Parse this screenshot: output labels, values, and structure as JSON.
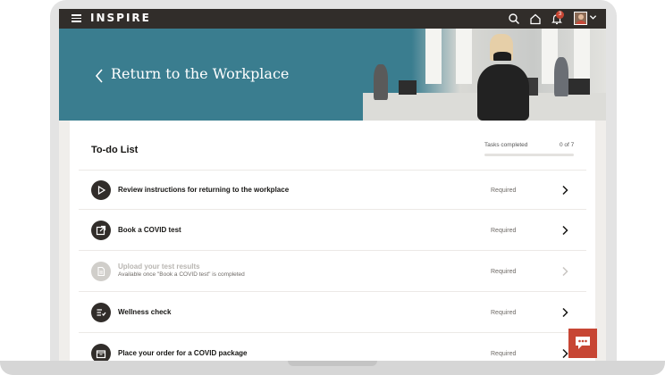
{
  "header": {
    "brand": "INSPIRE",
    "notification_count": "3"
  },
  "banner": {
    "title": "Return to the Workplace"
  },
  "todo": {
    "title": "To-do List",
    "tasks_label": "Tasks completed",
    "tasks_count": "0 of 7",
    "progress_fraction": 0
  },
  "items": [
    {
      "title": "Review instructions for returning to the workplace",
      "subtitle": "",
      "status": "Required",
      "icon": "play-icon",
      "enabled": true
    },
    {
      "title": "Book a COVID test",
      "subtitle": "",
      "status": "Required",
      "icon": "external-link-icon",
      "enabled": true
    },
    {
      "title": "Upload your test results",
      "subtitle": "Available once \"Book a COVID test\" is completed",
      "status": "Required",
      "icon": "document-icon",
      "enabled": false
    },
    {
      "title": "Wellness check",
      "subtitle": "",
      "status": "Required",
      "icon": "checklist-icon",
      "enabled": true
    },
    {
      "title": "Place your order for a COVID package",
      "subtitle": "",
      "status": "Required",
      "icon": "package-icon",
      "enabled": true
    }
  ],
  "colors": {
    "nav": "#312d2a",
    "banner": "#3a7d8f",
    "accent": "#c74634"
  }
}
